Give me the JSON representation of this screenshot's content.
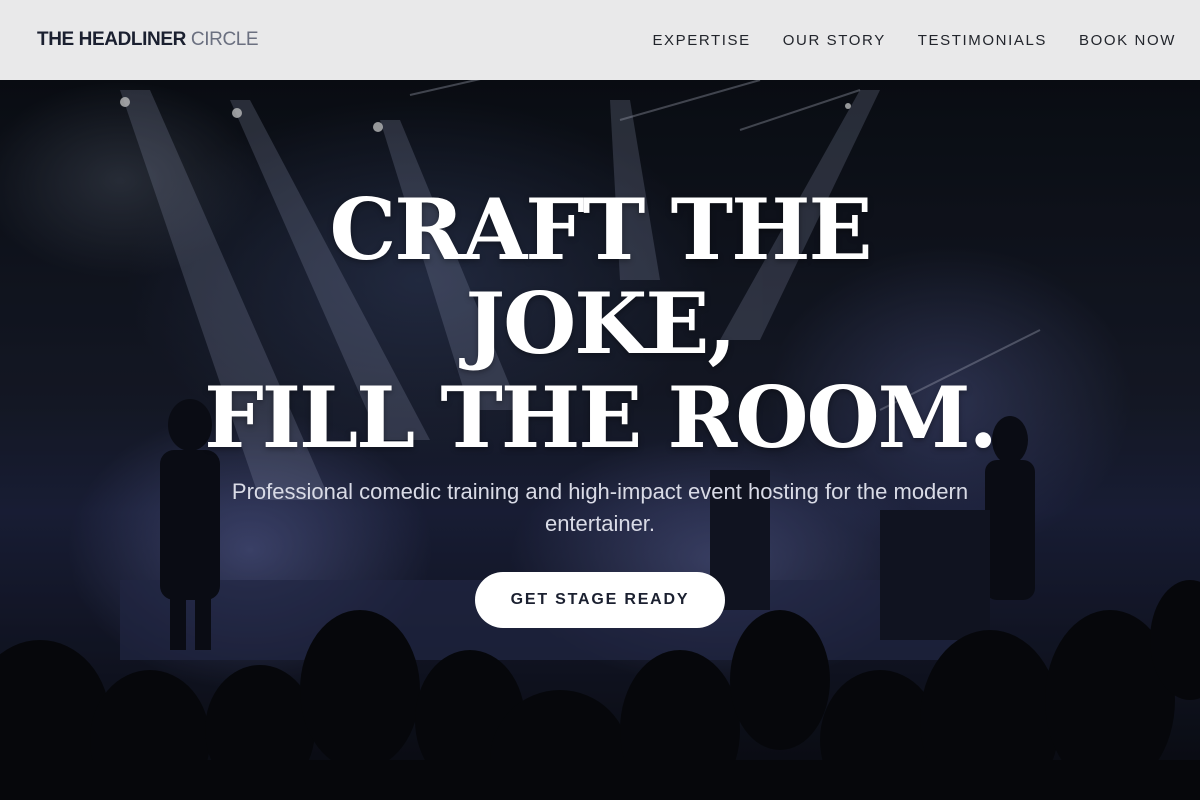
{
  "header": {
    "logo_strong": "THE HEADLINER",
    "logo_light": "CIRCLE",
    "nav": [
      {
        "label": "EXPERTISE"
      },
      {
        "label": "OUR STORY"
      },
      {
        "label": "TESTIMONIALS"
      },
      {
        "label": "BOOK NOW"
      }
    ]
  },
  "hero": {
    "headline_lines": [
      "CRAFT THE",
      "JOKE,",
      "FILL THE ROOM."
    ],
    "subtitle": "Professional comedic training and high-impact event hosting for the modern entertainer.",
    "cta_label": "GET STAGE READY",
    "background_image": "concert-stage-photo"
  },
  "colors": {
    "header_bg": "#e9e9ea",
    "headline": "#ffffff",
    "cta_bg": "#ffffff",
    "cta_text": "#1b2030"
  }
}
